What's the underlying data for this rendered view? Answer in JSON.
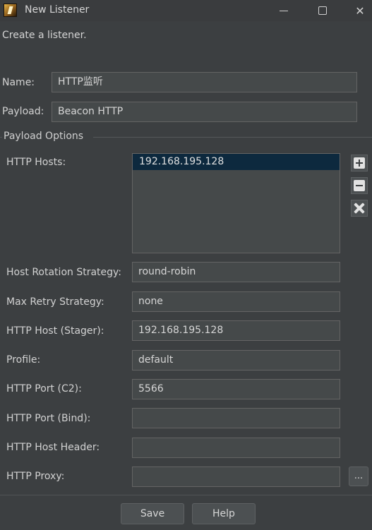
{
  "window": {
    "title": "New Listener",
    "icons": {
      "app": "cobalt-strike-app-icon",
      "minimize": "minimize-icon",
      "maximize": "maximize-icon",
      "close": "close-icon"
    },
    "close_glyph": "✕"
  },
  "intro": "Create a listener.",
  "form": {
    "name_label": "Name:",
    "name_value": "HTTP监听",
    "payload_label": "Payload:",
    "payload_value": "Beacon HTTP"
  },
  "payload_options": {
    "section_title": "Payload Options",
    "http_hosts_label": "HTTP Hosts:",
    "http_hosts": [
      "192.168.195.128"
    ],
    "host_buttons": [
      "add-icon",
      "remove-icon",
      "clear-icon"
    ],
    "fields": [
      {
        "label": "Host Rotation Strategy:",
        "value": "round-robin"
      },
      {
        "label": "Max Retry Strategy:",
        "value": "none"
      },
      {
        "label": "HTTP Host (Stager):",
        "value": "192.168.195.128"
      },
      {
        "label": "Profile:",
        "value": "default"
      },
      {
        "label": "HTTP Port (C2):",
        "value": "5566"
      },
      {
        "label": "HTTP Port (Bind):",
        "value": ""
      },
      {
        "label": "HTTP Host Header:",
        "value": ""
      },
      {
        "label": "HTTP Proxy:",
        "value": ""
      }
    ],
    "proxy_button_label": "..."
  },
  "buttons": {
    "save": "Save",
    "help": "Help"
  }
}
